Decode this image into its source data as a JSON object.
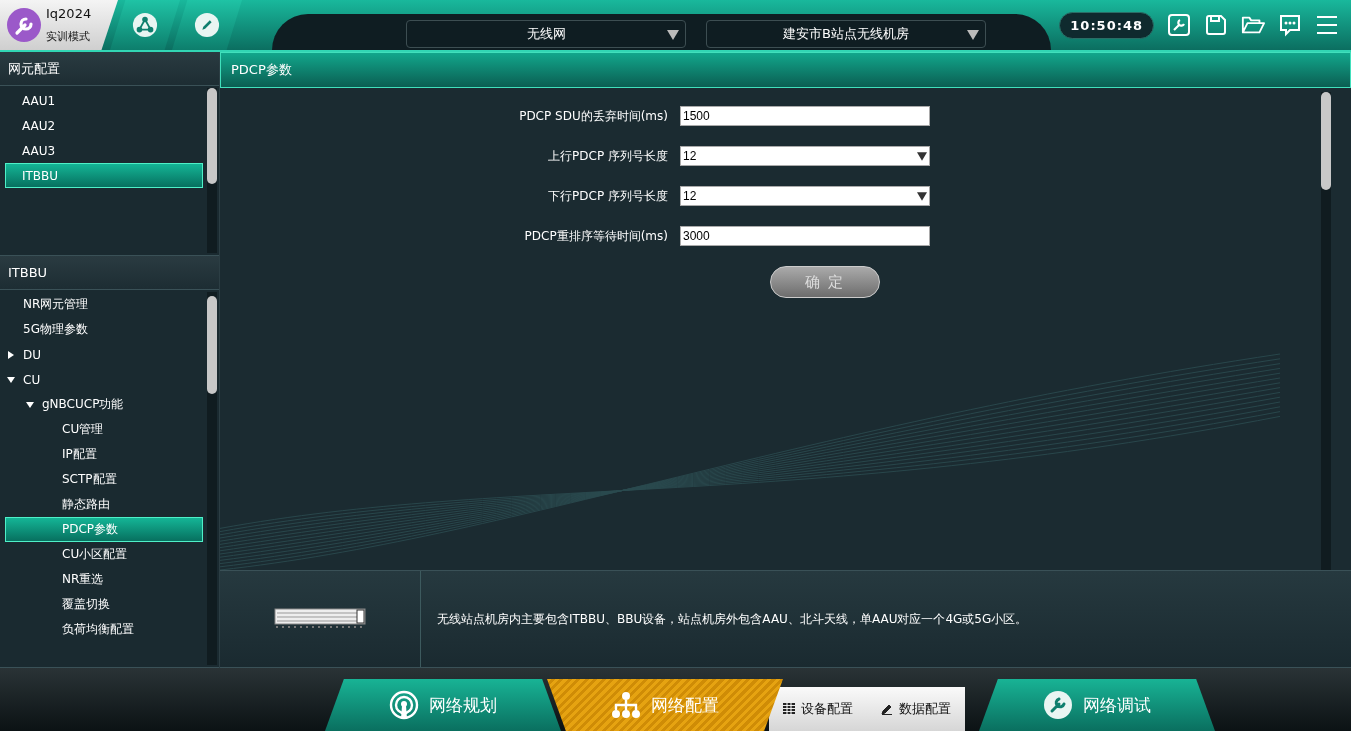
{
  "top_bar": {
    "app_title": "Iq2024",
    "mode": "实训模式",
    "network_select": "无线网",
    "room_select": "建安市B站点无线机房",
    "clock": "10:50:48"
  },
  "element_panel": {
    "title": "网元配置",
    "items": [
      {
        "label": "AAU1",
        "selected": false
      },
      {
        "label": "AAU2",
        "selected": false
      },
      {
        "label": "AAU3",
        "selected": false
      },
      {
        "label": "ITBBU",
        "selected": true
      }
    ]
  },
  "tree_panel": {
    "title": "ITBBU",
    "items": [
      {
        "label": "NR网元管理",
        "selected": false
      },
      {
        "label": "5G物理参数",
        "selected": false
      },
      {
        "label": "DU",
        "expanded": false,
        "selected": false
      },
      {
        "label": "CU",
        "expanded": true,
        "selected": false,
        "children": [
          {
            "label": "gNBCUCP功能",
            "expanded": true,
            "selected": false,
            "children": [
              {
                "label": "CU管理",
                "selected": false
              },
              {
                "label": "IP配置",
                "selected": false
              },
              {
                "label": "SCTP配置",
                "selected": false
              },
              {
                "label": "静态路由",
                "selected": false
              },
              {
                "label": "PDCP参数",
                "selected": true
              },
              {
                "label": "CU小区配置",
                "selected": false
              },
              {
                "label": "NR重选",
                "selected": false
              },
              {
                "label": "覆盖切换",
                "selected": false
              },
              {
                "label": "负荷均衡配置",
                "selected": false
              }
            ]
          }
        ]
      }
    ]
  },
  "content": {
    "title": "PDCP参数",
    "fields": [
      {
        "kind": "text",
        "label": "PDCP SDU的丢弃时间(ms)",
        "value": "1500"
      },
      {
        "kind": "select",
        "label": "上行PDCP 序列号长度",
        "value": "12"
      },
      {
        "kind": "select",
        "label": "下行PDCP 序列号长度",
        "value": "12"
      },
      {
        "kind": "text",
        "label": "PDCP重排序等待时间(ms)",
        "value": "3000"
      }
    ],
    "confirm_button": "确 定"
  },
  "info": {
    "text": "无线站点机房内主要包含ITBBU、BBU设备，站点机房外包含AAU、北斗天线，单AAU对应一个4G或5G小区。"
  },
  "bottom_nav": {
    "tabs": [
      {
        "label": "网络规划",
        "selected": false
      },
      {
        "label": "网络配置",
        "selected": true
      },
      {
        "label": "网络调试",
        "selected": false
      }
    ],
    "sub_tabs": [
      {
        "label": "设备配置"
      },
      {
        "label": "数据配置"
      }
    ]
  }
}
